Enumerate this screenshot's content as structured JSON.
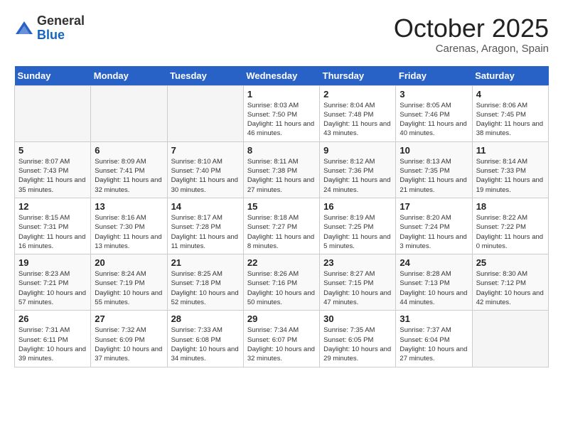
{
  "logo": {
    "general": "General",
    "blue": "Blue"
  },
  "title": "October 2025",
  "location": "Carenas, Aragon, Spain",
  "weekdays": [
    "Sunday",
    "Monday",
    "Tuesday",
    "Wednesday",
    "Thursday",
    "Friday",
    "Saturday"
  ],
  "weeks": [
    [
      {
        "day": "",
        "empty": true
      },
      {
        "day": "",
        "empty": true
      },
      {
        "day": "",
        "empty": true
      },
      {
        "day": "1",
        "sunrise": "8:03 AM",
        "sunset": "7:50 PM",
        "daylight": "11 hours and 46 minutes."
      },
      {
        "day": "2",
        "sunrise": "8:04 AM",
        "sunset": "7:48 PM",
        "daylight": "11 hours and 43 minutes."
      },
      {
        "day": "3",
        "sunrise": "8:05 AM",
        "sunset": "7:46 PM",
        "daylight": "11 hours and 40 minutes."
      },
      {
        "day": "4",
        "sunrise": "8:06 AM",
        "sunset": "7:45 PM",
        "daylight": "11 hours and 38 minutes."
      }
    ],
    [
      {
        "day": "5",
        "sunrise": "8:07 AM",
        "sunset": "7:43 PM",
        "daylight": "11 hours and 35 minutes."
      },
      {
        "day": "6",
        "sunrise": "8:09 AM",
        "sunset": "7:41 PM",
        "daylight": "11 hours and 32 minutes."
      },
      {
        "day": "7",
        "sunrise": "8:10 AM",
        "sunset": "7:40 PM",
        "daylight": "11 hours and 30 minutes."
      },
      {
        "day": "8",
        "sunrise": "8:11 AM",
        "sunset": "7:38 PM",
        "daylight": "11 hours and 27 minutes."
      },
      {
        "day": "9",
        "sunrise": "8:12 AM",
        "sunset": "7:36 PM",
        "daylight": "11 hours and 24 minutes."
      },
      {
        "day": "10",
        "sunrise": "8:13 AM",
        "sunset": "7:35 PM",
        "daylight": "11 hours and 21 minutes."
      },
      {
        "day": "11",
        "sunrise": "8:14 AM",
        "sunset": "7:33 PM",
        "daylight": "11 hours and 19 minutes."
      }
    ],
    [
      {
        "day": "12",
        "sunrise": "8:15 AM",
        "sunset": "7:31 PM",
        "daylight": "11 hours and 16 minutes."
      },
      {
        "day": "13",
        "sunrise": "8:16 AM",
        "sunset": "7:30 PM",
        "daylight": "11 hours and 13 minutes."
      },
      {
        "day": "14",
        "sunrise": "8:17 AM",
        "sunset": "7:28 PM",
        "daylight": "11 hours and 11 minutes."
      },
      {
        "day": "15",
        "sunrise": "8:18 AM",
        "sunset": "7:27 PM",
        "daylight": "11 hours and 8 minutes."
      },
      {
        "day": "16",
        "sunrise": "8:19 AM",
        "sunset": "7:25 PM",
        "daylight": "11 hours and 5 minutes."
      },
      {
        "day": "17",
        "sunrise": "8:20 AM",
        "sunset": "7:24 PM",
        "daylight": "11 hours and 3 minutes."
      },
      {
        "day": "18",
        "sunrise": "8:22 AM",
        "sunset": "7:22 PM",
        "daylight": "11 hours and 0 minutes."
      }
    ],
    [
      {
        "day": "19",
        "sunrise": "8:23 AM",
        "sunset": "7:21 PM",
        "daylight": "10 hours and 57 minutes."
      },
      {
        "day": "20",
        "sunrise": "8:24 AM",
        "sunset": "7:19 PM",
        "daylight": "10 hours and 55 minutes."
      },
      {
        "day": "21",
        "sunrise": "8:25 AM",
        "sunset": "7:18 PM",
        "daylight": "10 hours and 52 minutes."
      },
      {
        "day": "22",
        "sunrise": "8:26 AM",
        "sunset": "7:16 PM",
        "daylight": "10 hours and 50 minutes."
      },
      {
        "day": "23",
        "sunrise": "8:27 AM",
        "sunset": "7:15 PM",
        "daylight": "10 hours and 47 minutes."
      },
      {
        "day": "24",
        "sunrise": "8:28 AM",
        "sunset": "7:13 PM",
        "daylight": "10 hours and 44 minutes."
      },
      {
        "day": "25",
        "sunrise": "8:30 AM",
        "sunset": "7:12 PM",
        "daylight": "10 hours and 42 minutes."
      }
    ],
    [
      {
        "day": "26",
        "sunrise": "7:31 AM",
        "sunset": "6:11 PM",
        "daylight": "10 hours and 39 minutes."
      },
      {
        "day": "27",
        "sunrise": "7:32 AM",
        "sunset": "6:09 PM",
        "daylight": "10 hours and 37 minutes."
      },
      {
        "day": "28",
        "sunrise": "7:33 AM",
        "sunset": "6:08 PM",
        "daylight": "10 hours and 34 minutes."
      },
      {
        "day": "29",
        "sunrise": "7:34 AM",
        "sunset": "6:07 PM",
        "daylight": "10 hours and 32 minutes."
      },
      {
        "day": "30",
        "sunrise": "7:35 AM",
        "sunset": "6:05 PM",
        "daylight": "10 hours and 29 minutes."
      },
      {
        "day": "31",
        "sunrise": "7:37 AM",
        "sunset": "6:04 PM",
        "daylight": "10 hours and 27 minutes."
      },
      {
        "day": "",
        "empty": true
      }
    ]
  ]
}
